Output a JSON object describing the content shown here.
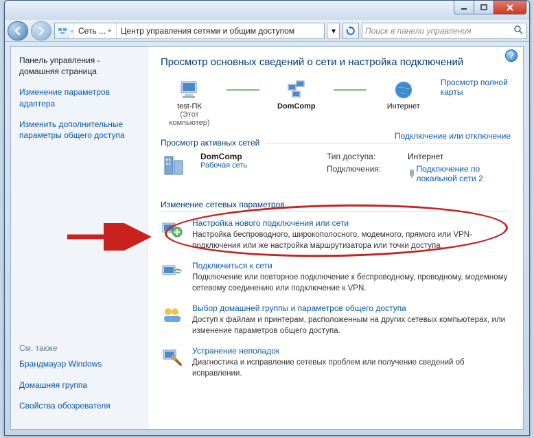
{
  "titlebar": {
    "min_tip": "Свернуть",
    "max_tip": "Развернуть",
    "close_tip": "Закрыть"
  },
  "breadcrumb": {
    "root": "Сеть ...",
    "current": "Центр управления сетями и общим доступом"
  },
  "search": {
    "placeholder": "Поиск в панели управления"
  },
  "sidebar": {
    "home": "Панель управления - домашняя страница",
    "items": [
      "Изменение параметров адаптера",
      "Изменить дополнительные параметры общего доступа"
    ],
    "see_also_title": "См. также",
    "see_also": [
      "Брандмауэр Windows",
      "Домашняя группа",
      "Свойства обозревателя"
    ]
  },
  "main": {
    "heading": "Просмотр основных сведений о сети и настройка подключений",
    "map": {
      "pc_name": "test-ПК",
      "pc_sub": "(Этот компьютер)",
      "domain": "DomComp",
      "internet": "Интернет",
      "full_map": "Просмотр полной карты"
    },
    "active_title": "Просмотр активных сетей",
    "connect_link": "Подключение или отключение",
    "active": {
      "name": "DomComp",
      "type": "Рабочая сеть",
      "access_label": "Тип доступа:",
      "access_value": "Интернет",
      "conn_label": "Подключения:",
      "conn_value": "Подключение по локальной сети 2"
    },
    "change_title": "Изменение сетевых параметров",
    "tasks": [
      {
        "title": "Настройка нового подключения или сети",
        "desc": "Настройка беспроводного, широкополосного, модемного, прямого или VPN-подключения или же настройка маршрутизатора или точки доступа."
      },
      {
        "title": "Подключиться к сети",
        "desc": "Подключение или повторное подключение к беспроводному, проводному, модемному сетевому соединению или подключение к VPN."
      },
      {
        "title": "Выбор домашней группы и параметров общего доступа",
        "desc": "Доступ к файлам и принтерам, расположенным на других сетевых компьютерах, или изменение параметров общего доступа."
      },
      {
        "title": "Устранение неполадок",
        "desc": "Диагностика и исправление сетевых проблем или получение сведений об исправлении."
      }
    ]
  },
  "help_tip": "?"
}
